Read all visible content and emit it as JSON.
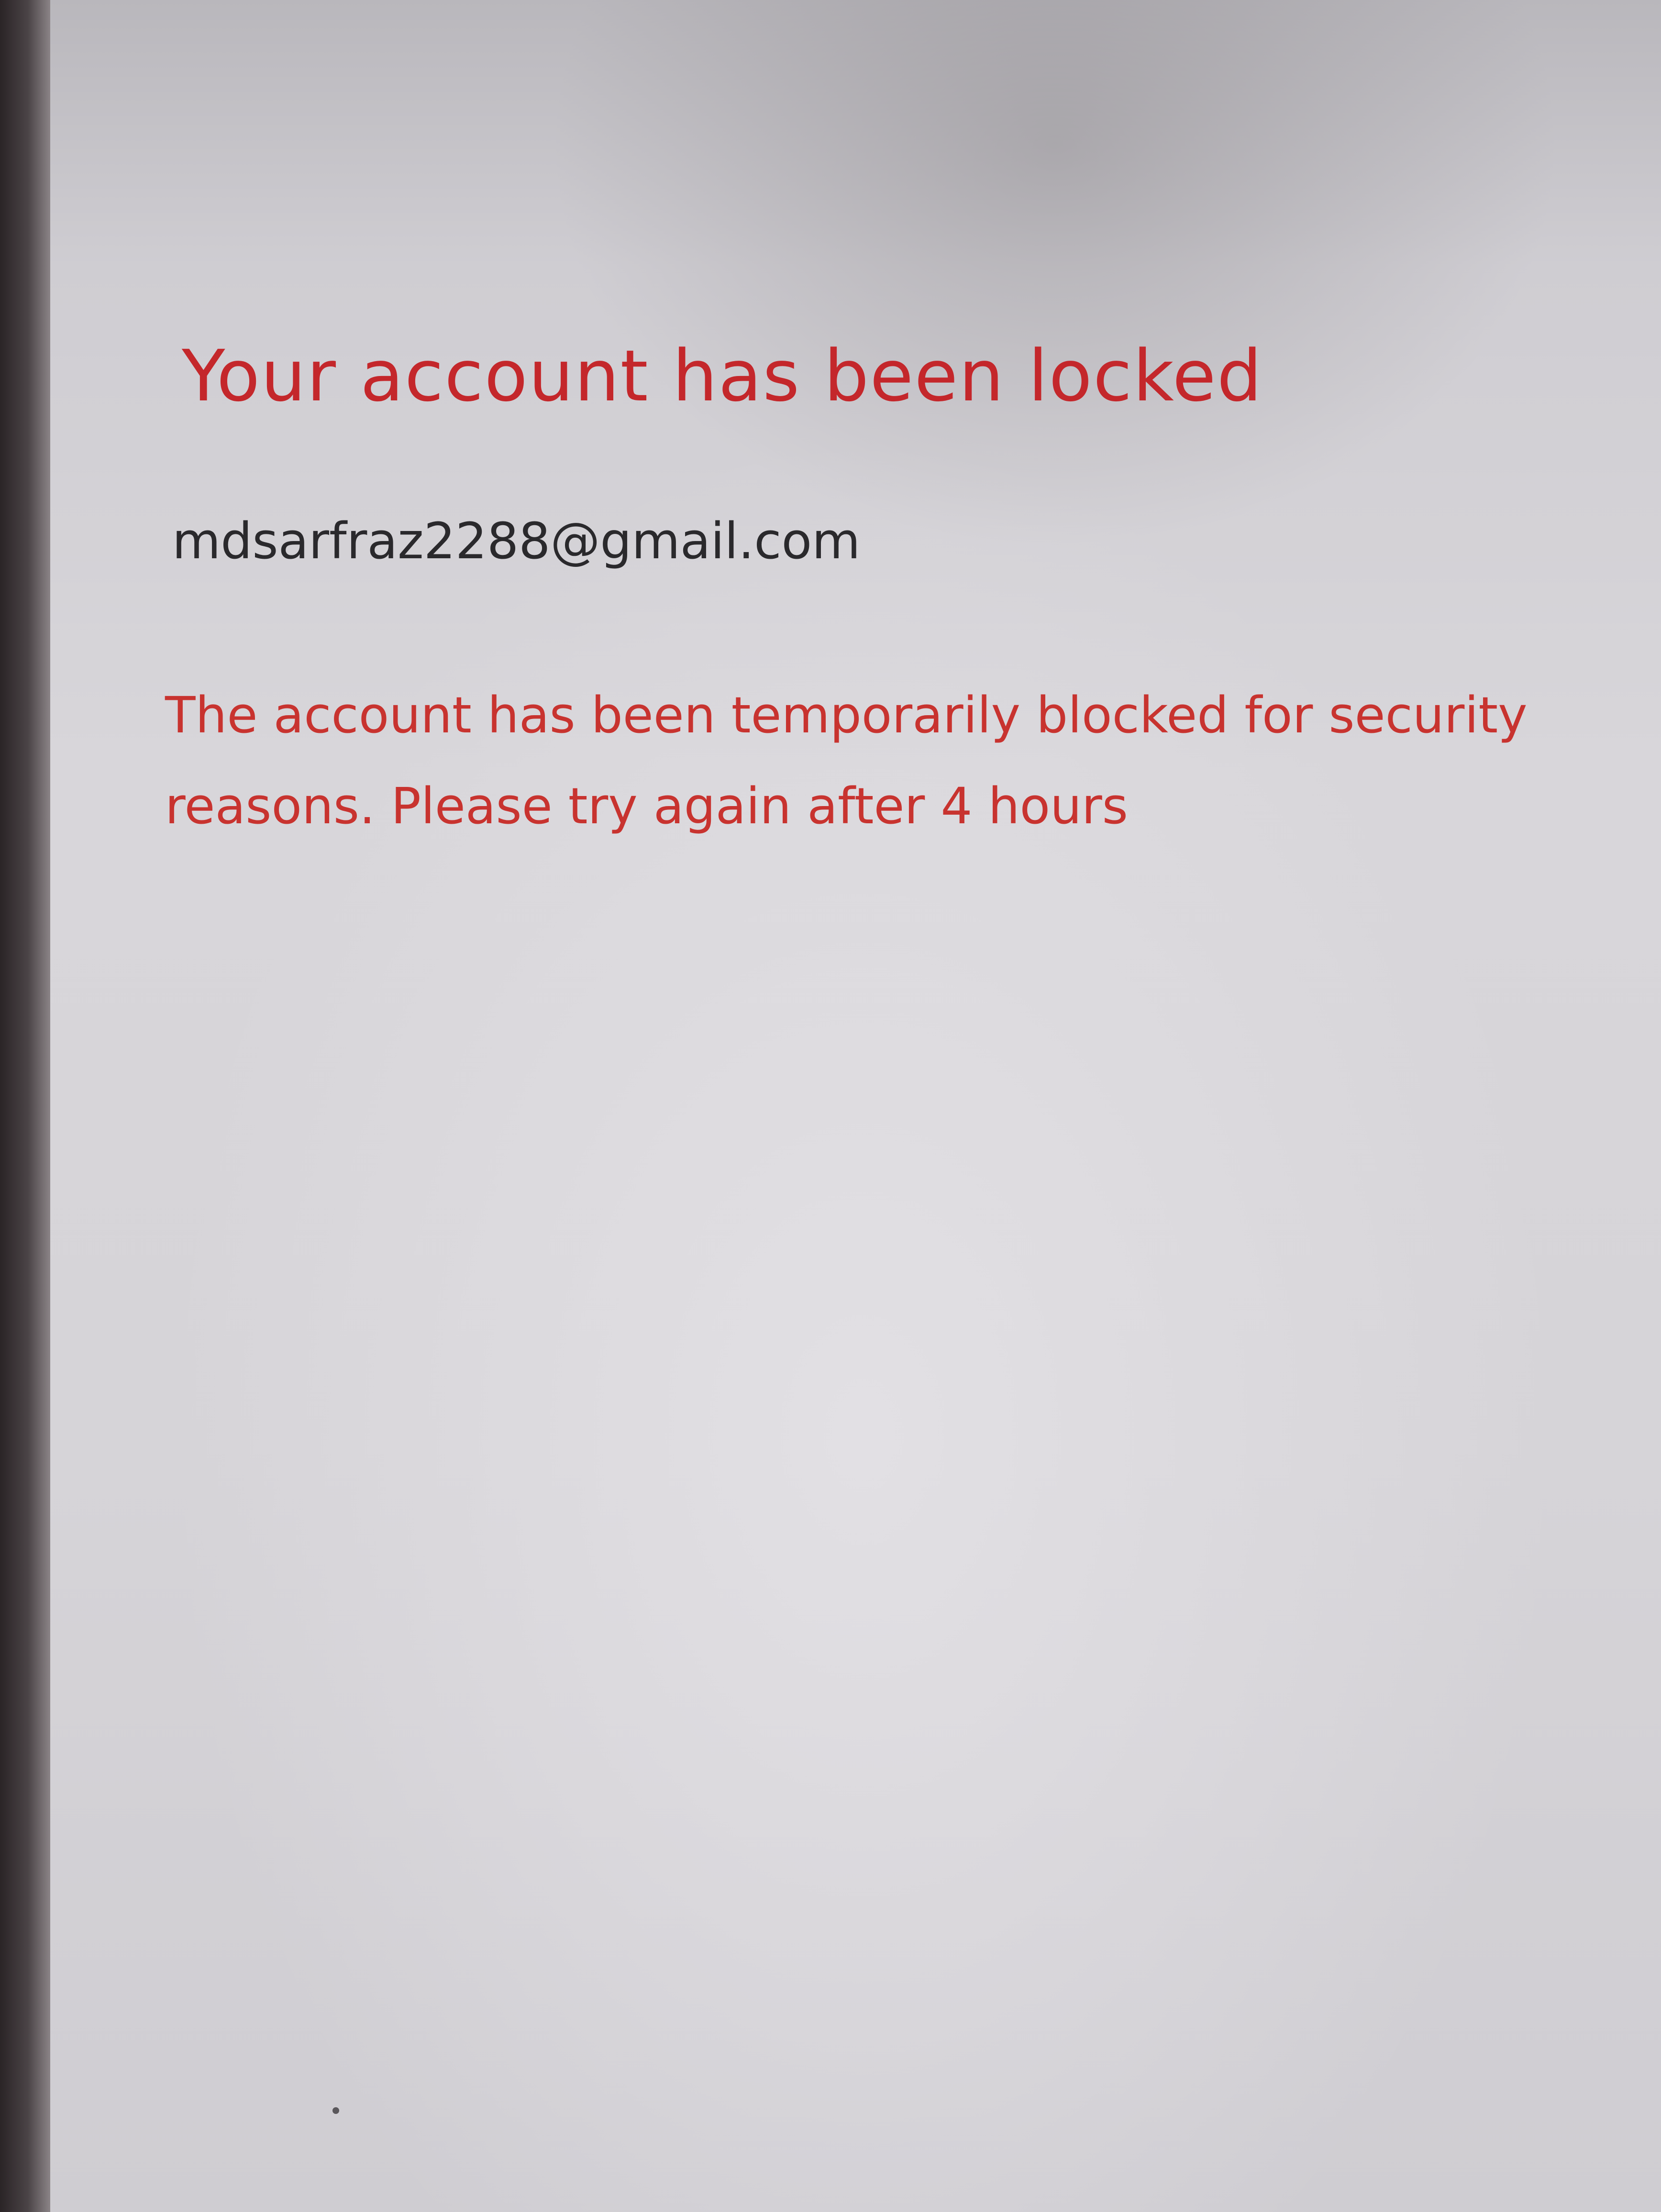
{
  "lock_screen": {
    "title": "Your account has been locked",
    "email": "mdsarfraz2288@gmail.com",
    "message": "The account has been temporarily blocked for security reasons. Please try again after 4 hours"
  },
  "colors": {
    "title": "#c4272b",
    "message": "#c8332f",
    "email": "#2a292c",
    "background": "#d8d6da"
  }
}
